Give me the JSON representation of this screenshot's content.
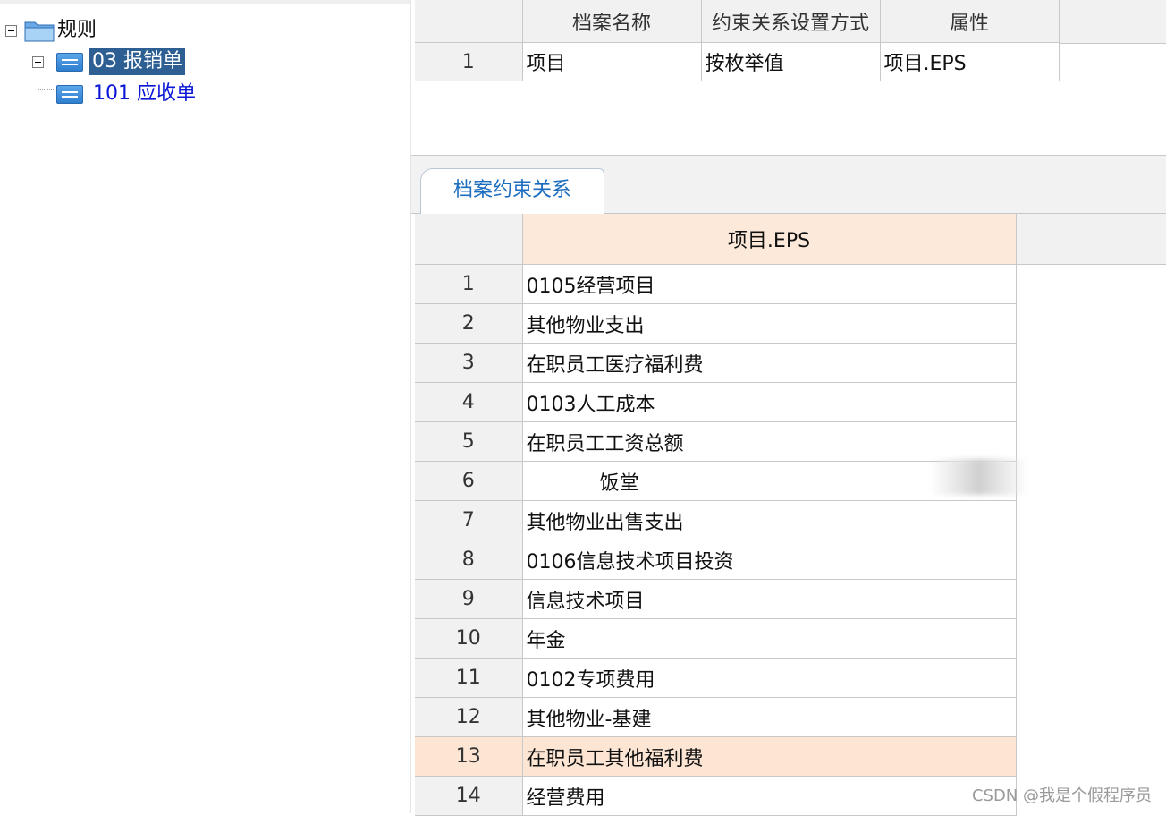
{
  "tree": {
    "root": {
      "label": "规则",
      "toggle": "minus"
    },
    "children": [
      {
        "label": "03 报销单",
        "selected": true,
        "toggle": "plus"
      },
      {
        "label": "101 应收单",
        "selected": false
      }
    ]
  },
  "top_grid": {
    "headers": [
      "档案名称",
      "约束关系设置方式",
      "属性"
    ],
    "rows": [
      {
        "num": "1",
        "cells": [
          "项目",
          "按枚举值",
          "项目.EPS"
        ]
      }
    ]
  },
  "tab": {
    "label": "档案约束关系"
  },
  "sub_grid": {
    "header": "项目.EPS",
    "rows": [
      {
        "num": "1",
        "value": "0105经营项目"
      },
      {
        "num": "2",
        "value": "其他物业支出"
      },
      {
        "num": "3",
        "value": "在职员工医疗福利费"
      },
      {
        "num": "4",
        "value": "0103人工成本"
      },
      {
        "num": "5",
        "value": "在职员工工资总额"
      },
      {
        "num": "6",
        "value": "饭堂"
      },
      {
        "num": "7",
        "value": "其他物业出售支出"
      },
      {
        "num": "8",
        "value": "0106信息技术项目投资"
      },
      {
        "num": "9",
        "value": "信息技术项目"
      },
      {
        "num": "10",
        "value": "年金"
      },
      {
        "num": "11",
        "value": "0102专项费用"
      },
      {
        "num": "12",
        "value": "其他物业-基建"
      },
      {
        "num": "13",
        "value": "在职员工其他福利费",
        "highlighted": true
      },
      {
        "num": "14",
        "value": "经营费用"
      }
    ]
  },
  "watermark": "CSDN @我是个假程序员",
  "colors": {
    "selected_bg": "#2d5f93",
    "link": "#0a16d6",
    "tab_text": "#1c6dbf",
    "highlight_row": "#fde5d3",
    "column_header": "#fde9d9"
  }
}
